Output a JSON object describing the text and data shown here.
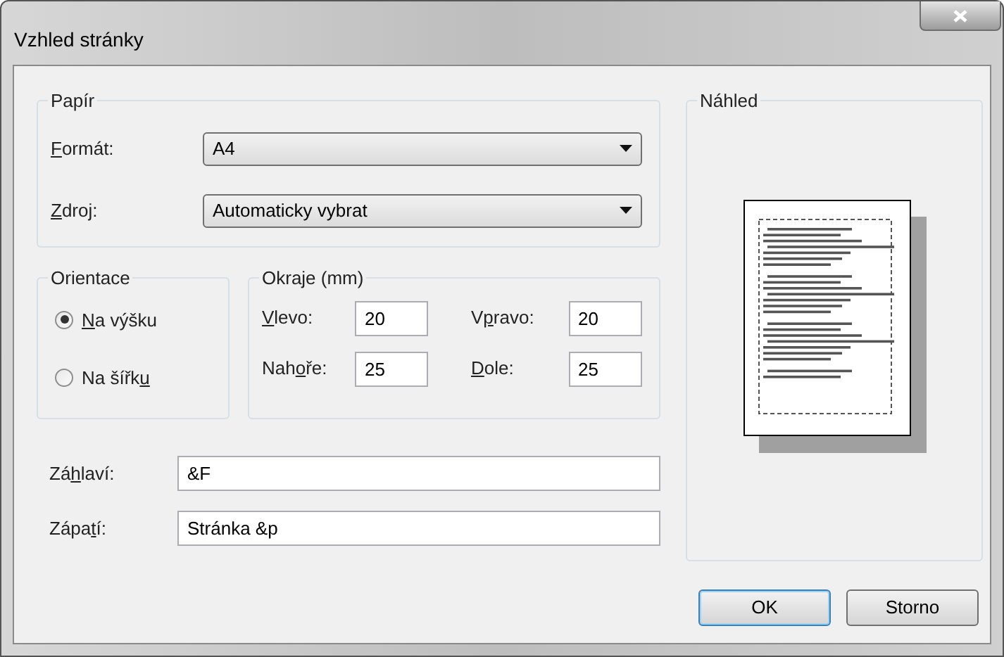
{
  "window": {
    "title": "Vzhled stránky"
  },
  "paper": {
    "title": "Papír",
    "fields": [
      {
        "label": {
          "key": "F",
          "after": "ormát:"
        },
        "value": "A4"
      },
      {
        "label": {
          "key": "Z",
          "after": "droj:"
        },
        "value": "Automaticky vybrat"
      }
    ]
  },
  "orientation": {
    "title": "Orientace",
    "options": [
      {
        "label": {
          "key": "N",
          "after": "a výšku"
        },
        "selected": true
      },
      {
        "label": {
          "before": "Na šířk",
          "key": "u"
        },
        "selected": false
      }
    ]
  },
  "margins": {
    "title": "Okraje (mm)",
    "fields": [
      {
        "label": {
          "key": "V",
          "after": "levo:"
        },
        "value": "20"
      },
      {
        "label": {
          "before": "V",
          "key": "p",
          "after": "ravo:"
        },
        "value": "20"
      },
      {
        "label": {
          "before": "Nah",
          "key": "o",
          "after": "ře:"
        },
        "value": "25"
      },
      {
        "label": {
          "key": "D",
          "after": "ole:"
        },
        "value": "25"
      }
    ]
  },
  "header": {
    "label": {
      "before": "Zá",
      "key": "h",
      "after": "laví:"
    },
    "value": "&F"
  },
  "footer": {
    "label": {
      "before": "Zápa",
      "key": "t",
      "after": "í:"
    },
    "value": "Stránka &p"
  },
  "preview": {
    "title": "Náhled"
  },
  "buttons": [
    {
      "label": "OK",
      "default": true
    },
    {
      "label": "Storno",
      "default": false
    }
  ]
}
